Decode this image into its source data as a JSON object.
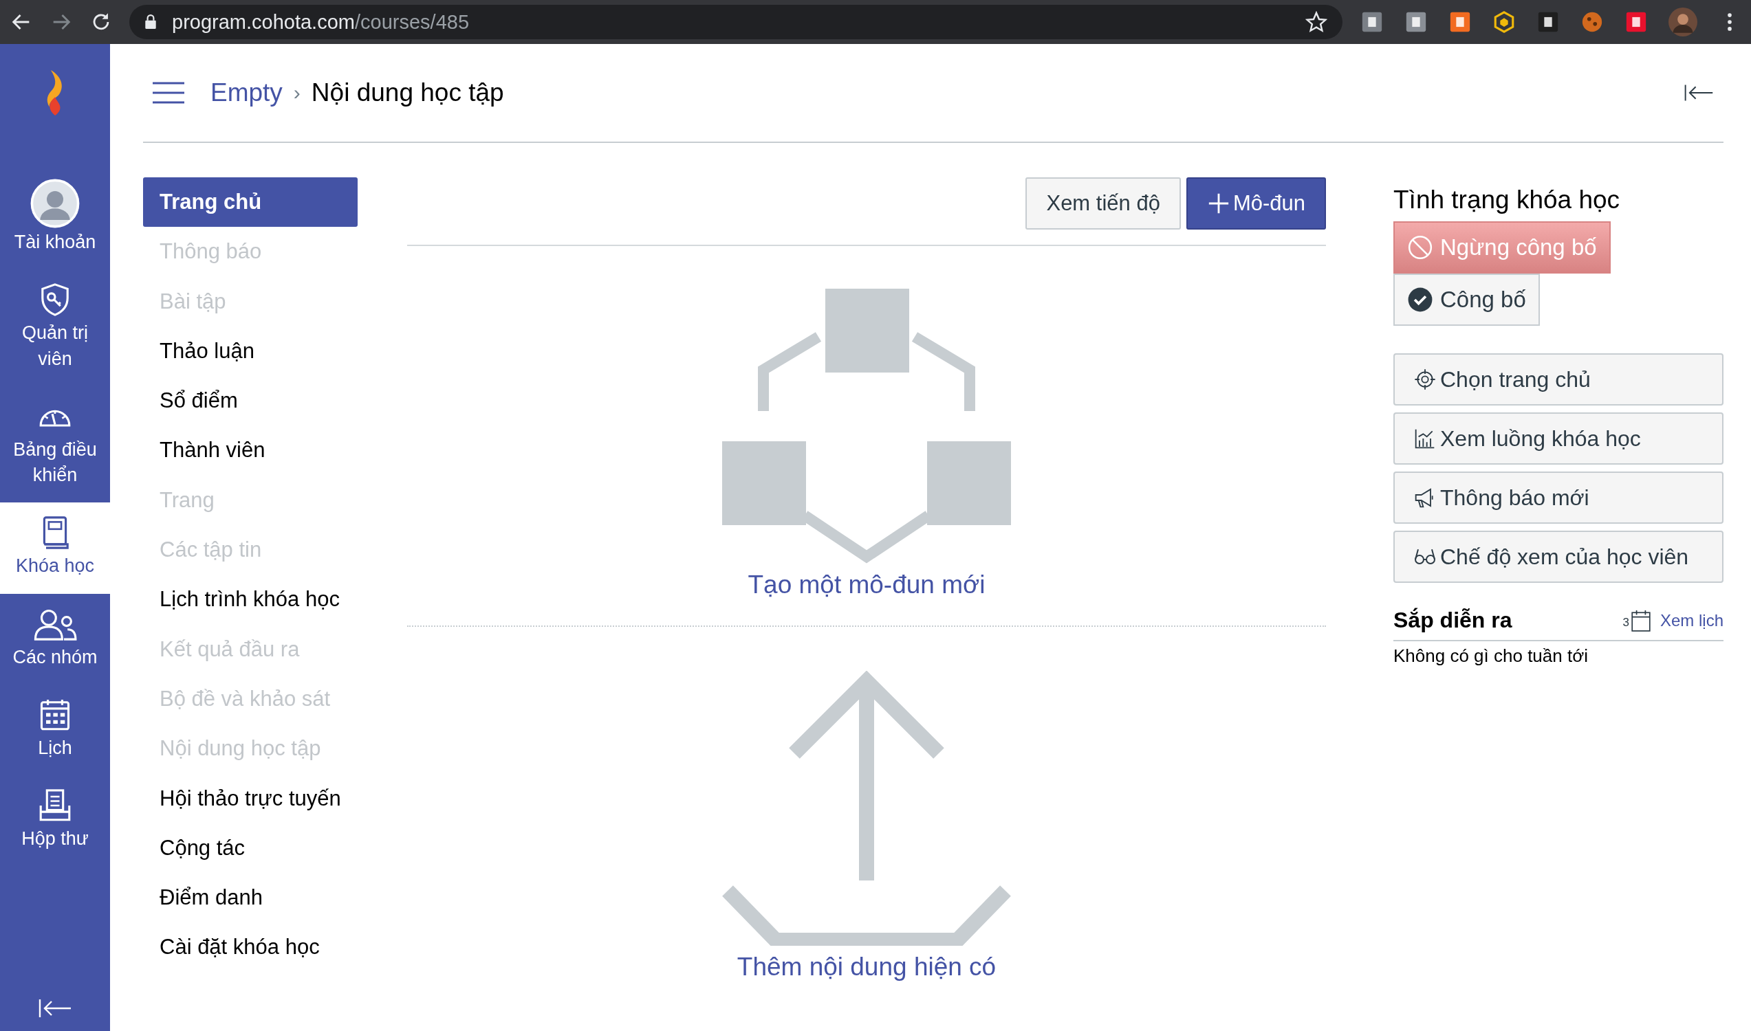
{
  "browser": {
    "url_host": "program.cohota.com",
    "url_path": "/courses/485"
  },
  "sidebar": {
    "items": [
      {
        "kind": "account",
        "label": "Tài khoản",
        "selected": false
      },
      {
        "kind": "admin",
        "label": "Quản trị viên",
        "selected": false
      },
      {
        "kind": "dashboard",
        "label": "Bảng điều khiển",
        "selected": false
      },
      {
        "kind": "courses",
        "label": "Khóa học",
        "selected": true
      },
      {
        "kind": "groups",
        "label": "Các nhóm",
        "selected": false
      },
      {
        "kind": "calendar",
        "label": "Lịch",
        "selected": false
      },
      {
        "kind": "inbox",
        "label": "Hộp thư",
        "selected": false
      }
    ]
  },
  "breadcrumb": {
    "parent": "Empty",
    "separator": "›",
    "current": "Nội dung học tập"
  },
  "course_nav": [
    {
      "label": "Trang chủ",
      "selected": true,
      "disabled": false
    },
    {
      "label": "Thông báo",
      "selected": false,
      "disabled": true
    },
    {
      "label": "Bài tập",
      "selected": false,
      "disabled": true
    },
    {
      "label": "Thảo luận",
      "selected": false,
      "disabled": false
    },
    {
      "label": "Sổ điểm",
      "selected": false,
      "disabled": false
    },
    {
      "label": "Thành viên",
      "selected": false,
      "disabled": false
    },
    {
      "label": "Trang",
      "selected": false,
      "disabled": true
    },
    {
      "label": "Các tập tin",
      "selected": false,
      "disabled": true
    },
    {
      "label": "Lịch trình khóa học",
      "selected": false,
      "disabled": false
    },
    {
      "label": "Kết quả đầu ra",
      "selected": false,
      "disabled": true
    },
    {
      "label": "Bộ đề và khảo sát",
      "selected": false,
      "disabled": true
    },
    {
      "label": "Nội dung học tập",
      "selected": false,
      "disabled": true
    },
    {
      "label": "Hội thảo trực tuyến",
      "selected": false,
      "disabled": false
    },
    {
      "label": "Cộng tác",
      "selected": false,
      "disabled": false
    },
    {
      "label": "Điểm danh",
      "selected": false,
      "disabled": false
    },
    {
      "label": "Cài đặt khóa học",
      "selected": false,
      "disabled": false
    }
  ],
  "toolbar": {
    "progress_button": "Xem tiến độ",
    "add_module_button": "Mô-đun"
  },
  "empty_state": {
    "create_module": "Tạo một mô-đun mới",
    "add_existing": "Thêm nội dung hiện có"
  },
  "course_status": {
    "title": "Tình trạng khóa học",
    "options": [
      {
        "kind": "unpublish",
        "label": "Ngừng công bố",
        "selected": true
      },
      {
        "kind": "publish",
        "label": "Công bố",
        "selected": false
      }
    ]
  },
  "actions": [
    {
      "kind": "target",
      "label": "Chọn trang chủ"
    },
    {
      "kind": "chart",
      "label": "Xem luồng khóa học"
    },
    {
      "kind": "megaphone",
      "label": "Thông báo mới"
    },
    {
      "kind": "glasses",
      "label": "Chế độ xem của học viên"
    }
  ],
  "upcoming": {
    "title": "Sắp diễn ra",
    "calendar_link": "Xem lịch",
    "calendar_day": "3",
    "empty": "Không có gì cho tuần tới"
  }
}
